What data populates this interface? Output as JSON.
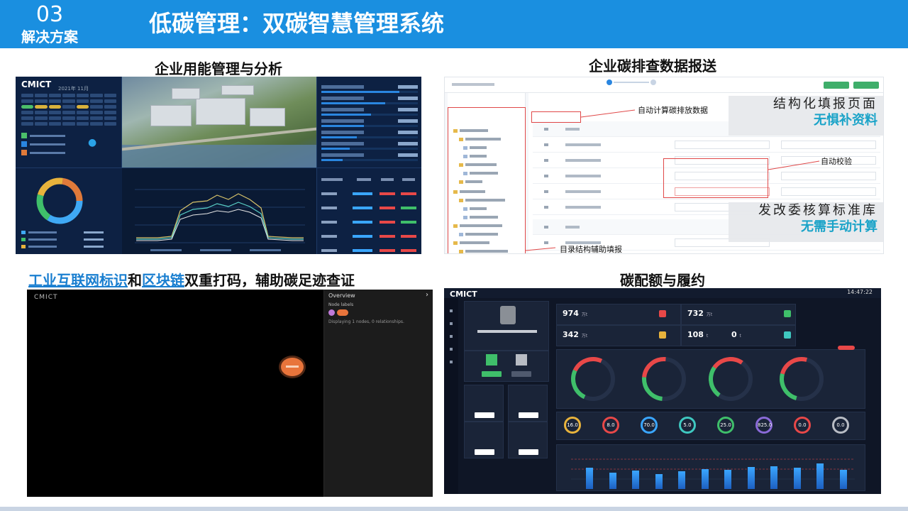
{
  "header": {
    "section_number": "03",
    "section_label": "解决方案",
    "title": "低碳管理：双碳智慧管理系统"
  },
  "panels": {
    "energy": {
      "title": "企业用能管理与分析",
      "logo": "CMICT",
      "date": "2021年 11月"
    },
    "report": {
      "title": "企业碳排查数据报送",
      "callout_auto_calc": "自动计算碳排放数据",
      "callout_auto_check": "自动校验",
      "callout_tree": "目录结构辅助填报",
      "overlay1_line1": "结构化填报页面",
      "overlay1_line2": "无惧补资料",
      "overlay2_line1": "发改委核算标准库",
      "overlay2_line2": "无需手动计算"
    },
    "blockchain": {
      "title_part1": "工业互联网标识",
      "title_part2": "和",
      "title_part3": "区块链",
      "title_part4": "双重打码，辅助碳足迹查证",
      "logo": "CMICT",
      "overview": "Overview",
      "node_labels": "Node labels",
      "displaying": "Displaying 1 nodes, 0 relationships."
    },
    "quota": {
      "title": "碳配额与履约",
      "logo": "CMICT",
      "time": "14:47:22",
      "stats": [
        {
          "value": "974",
          "unit": "万t"
        },
        {
          "value": "732",
          "unit": "万t"
        },
        {
          "value": "342",
          "unit": "万t"
        },
        {
          "value": "108",
          "unit": "t"
        },
        {
          "value": "0",
          "unit": "t"
        }
      ],
      "rings": [
        "16.0",
        "8.0",
        "70.0",
        "5.0",
        "25.0",
        "825.0",
        "0.0",
        "0.0"
      ],
      "bars": [
        0.55,
        0.42,
        0.48,
        0.38,
        0.46,
        0.52,
        0.5,
        0.58,
        0.6,
        0.55,
        0.66,
        0.5
      ],
      "colors": {
        "accent": "#3aa6ff",
        "red": "#e84848",
        "green": "#3fbf6a"
      }
    }
  }
}
